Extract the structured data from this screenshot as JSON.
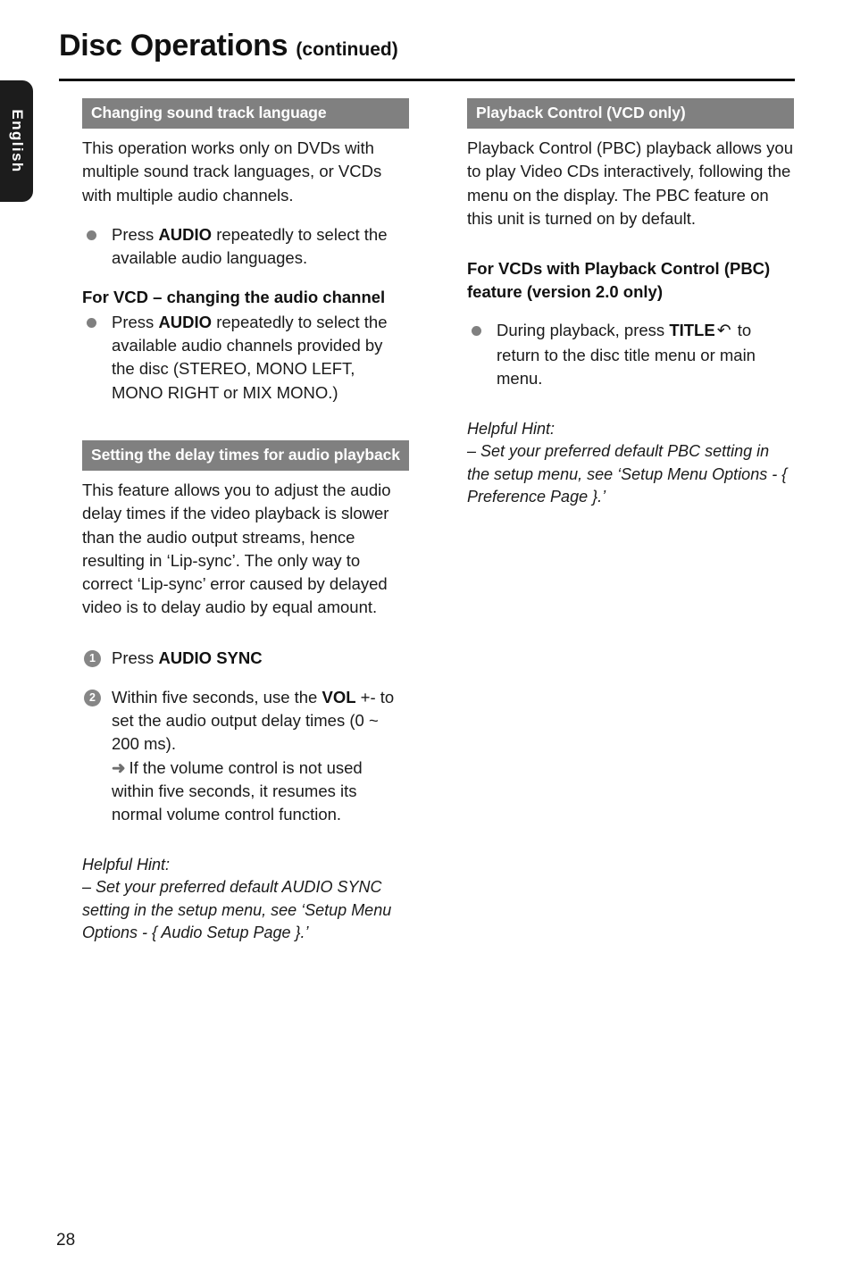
{
  "header": {
    "title": "Disc Operations",
    "continued": "(continued)"
  },
  "language_tab": {
    "label": "English"
  },
  "left_column": {
    "section1": {
      "bar_title": "Changing sound track language",
      "intro": "This operation works only on DVDs with multiple sound track languages, or VCDs with multiple audio channels.",
      "bullet1_pre": "Press ",
      "bullet1_bold": "AUDIO",
      "bullet1_post": " repeatedly to select the available audio languages.",
      "subhead": "For VCD – changing the audio channel",
      "bullet2_pre": "Press ",
      "bullet2_bold": "AUDIO",
      "bullet2_post": " repeatedly to select the available audio channels provided by the disc (STEREO, MONO LEFT, MONO RIGHT or MIX MONO.)"
    },
    "section2": {
      "bar_title": "Setting the delay times for audio playback",
      "intro": "This feature allows you to adjust the audio delay times if the video playback is slower than the audio output streams, hence resulting in ‘Lip-sync’. The only way to correct ‘Lip-sync’ error caused by delayed video is to delay audio by equal amount.",
      "step1_num": "1",
      "step1_pre": "Press ",
      "step1_bold": "AUDIO SYNC",
      "step2_num": "2",
      "step2_pre": "Within five seconds, use the ",
      "step2_bold": "VOL",
      "step2_post": " +- to set the audio output delay times (0 ~ 200 ms).",
      "step2_arrow_icon": "➜",
      "step2_arrow_text": "If the volume control is not used within five seconds, it resumes its normal volume control function.",
      "hint_title": "Helpful Hint:",
      "hint_body": "–  Set your preferred default AUDIO SYNC setting in the setup menu, see ‘Setup Menu Options - { Audio Setup Page }.’"
    }
  },
  "right_column": {
    "section1": {
      "bar_title": "Playback Control (VCD only)",
      "intro": "Playback Control (PBC) playback allows you to play Video CDs interactively, following the menu on the display. The PBC feature on this unit is turned on by default.",
      "subhead": "For VCDs with Playback Control (PBC) feature (version 2.0 only)",
      "bullet1_pre": "During playback, press ",
      "bullet1_bold": "TITLE",
      "bullet1_icon": "↶",
      "bullet1_post": " to return to the disc title menu or main menu.",
      "hint_title": "Helpful Hint:",
      "hint_body": "–  Set your preferred default PBC setting in the setup menu, see ‘Setup Menu Options - { Preference Page }.’"
    }
  },
  "footer": {
    "page_number": "28"
  },
  "colors": {
    "section_bar": "#808080",
    "bullet": "#808080",
    "tab_background": "#1c1c1c",
    "text": "#1a1a1a"
  }
}
